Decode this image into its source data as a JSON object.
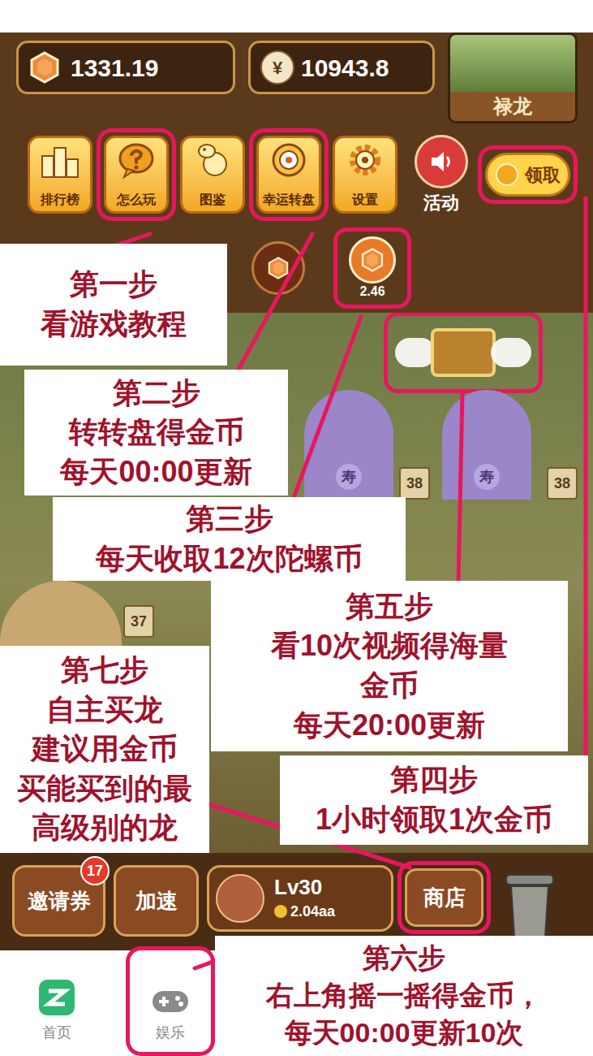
{
  "status": {
    "gems": "1331.19",
    "money_symbol": "¥",
    "money": "10943.8"
  },
  "profile": {
    "name": "禄龙"
  },
  "toolbar": [
    {
      "label": "排行榜",
      "kind": "tile",
      "highlighted": false
    },
    {
      "label": "怎么玩",
      "kind": "tile",
      "highlighted": true
    },
    {
      "label": "图鉴",
      "kind": "tile",
      "highlighted": false
    },
    {
      "label": "幸运转盘",
      "kind": "tile",
      "highlighted": true
    },
    {
      "label": "设置",
      "kind": "tile",
      "highlighted": false
    },
    {
      "label": "活动",
      "kind": "round",
      "highlighted": false
    }
  ],
  "claim": {
    "label": "领取",
    "highlighted": true
  },
  "gyro_coins": [
    {
      "kind": "idle",
      "highlighted": false
    },
    {
      "kind": "ready",
      "value": "2.46",
      "highlighted": true
    }
  ],
  "chest": {
    "highlighted": true
  },
  "dragons": [
    {
      "kind": "purple",
      "badge": "寿",
      "level": "38"
    },
    {
      "kind": "purple",
      "badge": "寿",
      "level": "38"
    },
    {
      "kind": "gold",
      "level": "37"
    }
  ],
  "bottom_bar": {
    "invite": {
      "label": "邀请券",
      "badge": "17"
    },
    "speed": {
      "label": "加速"
    },
    "level": {
      "level": "Lv30",
      "coins": "2.04aa"
    },
    "shop": {
      "label": "商店",
      "highlighted": true
    }
  },
  "nav": [
    {
      "label": "首页",
      "highlighted": false
    },
    {
      "label": "娱乐",
      "highlighted": true
    }
  ],
  "annotations": [
    {
      "title": "第一步",
      "lines": [
        "看游戏教程"
      ]
    },
    {
      "title": "第二步",
      "lines": [
        "转转盘得金币",
        "每天00:00更新"
      ]
    },
    {
      "title": "第三步",
      "lines": [
        "每天收取12次陀螺币"
      ]
    },
    {
      "title": "第四步",
      "lines": [
        "1小时领取1次金币"
      ]
    },
    {
      "title": "第五步",
      "lines": [
        "看10次视频得海量",
        "金币",
        "每天20:00更新"
      ]
    },
    {
      "title": "第六步",
      "lines": [
        "右上角摇一摇得金币，",
        "每天00:00更新10次"
      ]
    },
    {
      "title": "第七步",
      "lines": [
        "自主买龙",
        "建议用金币",
        "买能买到的最",
        "高级别的龙"
      ]
    }
  ]
}
